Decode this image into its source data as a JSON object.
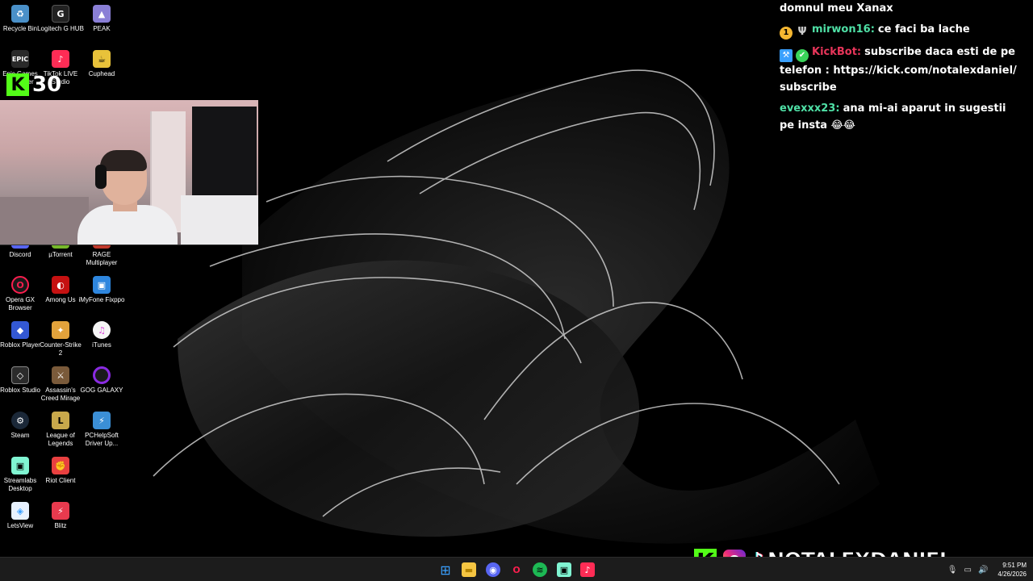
{
  "desktop_icons": [
    {
      "label": "Recycle Bin",
      "icon": "recycle-bin-icon",
      "color": "#4a90c8"
    },
    {
      "label": "Logitech G HUB",
      "icon": "logitech-icon",
      "color": "#222222"
    },
    {
      "label": "PEAK",
      "icon": "peak-icon",
      "color": "#8a7fd6"
    },
    {
      "label": "Epic Games Launcher",
      "icon": "epic-icon",
      "color": "#2a2a2a"
    },
    {
      "label": "TikTok LIVE Studio",
      "icon": "tiktok-live-icon",
      "color": "#fe2c55"
    },
    {
      "label": "Cuphead",
      "icon": "cuphead-icon",
      "color": "#e8c23a"
    },
    {
      "label": "Discord",
      "icon": "discord-icon",
      "color": "#5865f2"
    },
    {
      "label": "µTorrent",
      "icon": "utorrent-icon",
      "color": "#76b82a"
    },
    {
      "label": "RAGE Multiplayer",
      "icon": "rage-icon",
      "color": "#c0392b"
    },
    {
      "label": "Opera GX Browser",
      "icon": "opera-gx-icon",
      "color": "#fa1e4e"
    },
    {
      "label": "Among Us",
      "icon": "among-us-icon",
      "color": "#c51111"
    },
    {
      "label": "iMyFone Fixppo",
      "icon": "imyfone-icon",
      "color": "#2e86de"
    },
    {
      "label": "Roblox Player",
      "icon": "roblox-player-icon",
      "color": "#3358d4"
    },
    {
      "label": "Counter-Strike 2",
      "icon": "cs2-icon",
      "color": "#e2a23b"
    },
    {
      "label": "iTunes",
      "icon": "itunes-icon",
      "color": "#f5f5f5"
    },
    {
      "label": "Roblox Studio",
      "icon": "roblox-studio-icon",
      "color": "#2b2b2b"
    },
    {
      "label": "Assassin's Creed Mirage",
      "icon": "ac-mirage-icon",
      "color": "#7a5a3a"
    },
    {
      "label": "GOG GALAXY",
      "icon": "gog-galaxy-icon",
      "color": "#8a2be2"
    },
    {
      "label": "Steam",
      "icon": "steam-icon",
      "color": "#1b2838"
    },
    {
      "label": "League of Legends",
      "icon": "lol-icon",
      "color": "#c8a84b"
    },
    {
      "label": "PCHelpSoft Driver Up...",
      "icon": "pchelpsoft-icon",
      "color": "#3b8fd6"
    },
    {
      "label": "Streamlabs Desktop",
      "icon": "streamlabs-icon",
      "color": "#80f5d2"
    },
    {
      "label": "Riot Client",
      "icon": "riot-client-icon",
      "color": "#e84040"
    },
    {
      "label": "LetsView",
      "icon": "letsview-icon",
      "color": "#3aa0ff"
    },
    {
      "label": "Blitz",
      "icon": "blitz-icon",
      "color": "#e83a4e"
    }
  ],
  "kick_badge": {
    "letter": "K",
    "count": "30"
  },
  "chat": [
    {
      "user": "",
      "text": "domnul meu Xanax",
      "user_color": "#ffffff",
      "badges": []
    },
    {
      "user": "mirwon16:",
      "text": "ce faci ba lache",
      "user_color": "#4fe0a6",
      "badges": [
        "1",
        "Ψ"
      ]
    },
    {
      "user": "KickBot:",
      "text": "subscribe daca esti de pe telefon : https://kick.com/notalexdaniel/subscribe",
      "user_color": "#e8355a",
      "badges": [
        "⚒",
        "✔"
      ]
    },
    {
      "user": "evexxx23:",
      "text": "ana mi-ai aparut in sugestii pe insta 😂😂",
      "user_color": "#4fe0a6",
      "badges": []
    }
  ],
  "branding": {
    "kick_letter": "K",
    "tiktok_glyph": "♪",
    "name": "NOTALEXDANIEL"
  },
  "taskbar": {
    "apps": [
      {
        "name": "start",
        "glyph": "⊞",
        "color": "#3aa0ff"
      },
      {
        "name": "file-explorer",
        "glyph": "▬",
        "color": "#f5c542"
      },
      {
        "name": "discord",
        "glyph": "◉",
        "color": "#5865f2"
      },
      {
        "name": "opera-gx",
        "glyph": "O",
        "color": "#fa1e4e"
      },
      {
        "name": "spotify",
        "glyph": "≋",
        "color": "#1db954"
      },
      {
        "name": "streamlabs",
        "glyph": "▣",
        "color": "#80f5d2"
      },
      {
        "name": "tiktok-live",
        "glyph": "♪",
        "color": "#fe2c55"
      }
    ],
    "time": "9:51 PM",
    "date": "4/26/2026"
  }
}
